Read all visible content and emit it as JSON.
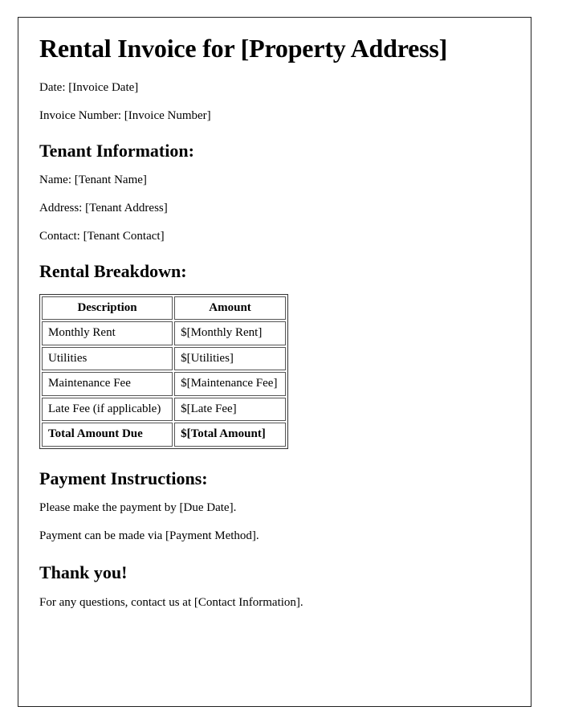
{
  "document": {
    "title": "Rental Invoice for [Property Address]",
    "meta": {
      "date_line": "Date: [Invoice Date]",
      "invoice_number_line": "Invoice Number: [Invoice Number]"
    },
    "tenant_section": {
      "heading": "Tenant Information:",
      "name_line": "Name: [Tenant Name]",
      "address_line": "Address: [Tenant Address]",
      "contact_line": "Contact: [Tenant Contact]"
    },
    "breakdown_section": {
      "heading": "Rental Breakdown:",
      "table": {
        "columns": [
          "Description",
          "Amount"
        ],
        "rows": [
          {
            "description": "Monthly Rent",
            "amount": "$[Monthly Rent]",
            "emphasis": false
          },
          {
            "description": "Utilities",
            "amount": "$[Utilities]",
            "emphasis": false
          },
          {
            "description": "Maintenance Fee",
            "amount": "$[Maintenance Fee]",
            "emphasis": false
          },
          {
            "description": "Late Fee (if applicable)",
            "amount": "$[Late Fee]",
            "emphasis": false
          },
          {
            "description": "Total Amount Due",
            "amount": "$[Total Amount]",
            "emphasis": true
          }
        ]
      }
    },
    "payment_section": {
      "heading": "Payment Instructions:",
      "due_line": "Please make the payment by [Due Date].",
      "method_line": "Payment can be made via [Payment Method]."
    },
    "closing_section": {
      "heading": "Thank you!",
      "contact_line": "For any questions, contact us at [Contact Information]."
    }
  },
  "colors": {
    "page_background": "#ffffff",
    "text": "#000000",
    "page_border": "#222222",
    "table_outer_border": "#333333",
    "table_cell_border": "#555555"
  }
}
